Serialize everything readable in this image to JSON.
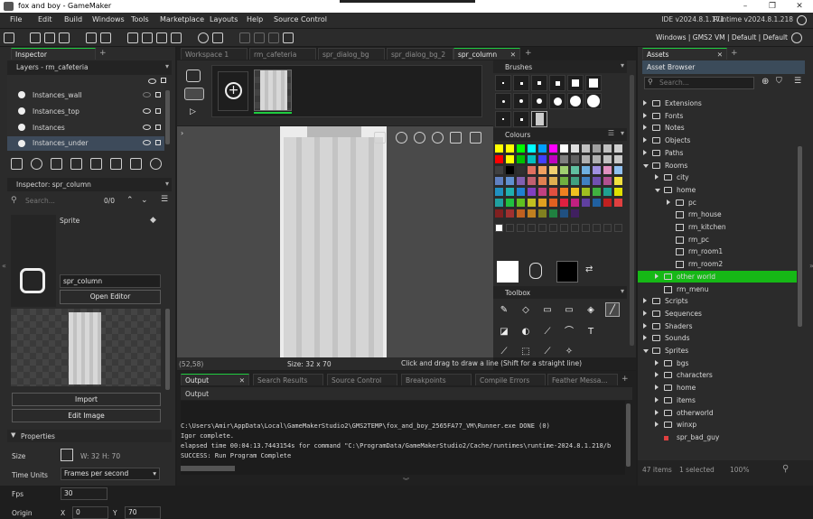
{
  "window": {
    "title": "fox and boy - GameMaker"
  },
  "menu": [
    "File",
    "Edit",
    "Build",
    "Windows",
    "Tools",
    "Marketplace",
    "Layouts",
    "Help",
    "Source Control"
  ],
  "version": {
    "ide": "IDE v2024.8.1.171",
    "runtime": "Runtime v2024.8.1.218"
  },
  "toolbar": {
    "right_label": "Windows | GMS2 VM | Default | Default"
  },
  "left": {
    "tab": "Inspector",
    "layers_title": "Layers - rm_cafeteria",
    "layers": [
      "Instances_wall",
      "Instances_top",
      "Instances",
      "Instances_under"
    ],
    "inspector_title": "Inspector: spr_column",
    "search_placeholder": "Search...",
    "counter": "0/0",
    "sprite_label": "Sprite",
    "sprite_name": "spr_column",
    "open_editor": "Open Editor",
    "import": "Import",
    "edit_image": "Edit Image",
    "properties": "Properties",
    "size_label": "Size",
    "size_w": "W: 32",
    "size_h": "H: 70",
    "time_units_label": "Time Units",
    "time_units_value": "Frames per second",
    "fps_label": "Fps",
    "fps_value": "30",
    "origin_label": "Origin",
    "origin_x_label": "X",
    "origin_x": "0",
    "origin_y_label": "Y",
    "origin_y": "70"
  },
  "center": {
    "tabs": [
      "Workspace 1",
      "rm_cafeteria",
      "spr_dialog_bg",
      "spr_dialog_bg_2",
      "spr_column"
    ],
    "active_tab": "spr_column",
    "coords": "(52,58)",
    "size": "Size: 32 x 70",
    "hint": "Click and drag to draw a line (Shift for a straight line)"
  },
  "brushes": {
    "title": "Brushes"
  },
  "colours": {
    "title": "Colours",
    "swatches": [
      [
        "#ffff00",
        "#ffff00",
        "#00ff00",
        "#00ffff",
        "#00a0ff",
        "#ff00ff",
        "#ffffff",
        "#e0e0e0",
        "#c0c0c0",
        "#a0a0a0",
        "#c0c0c0",
        "#d0d0d0"
      ],
      [
        "#ff0000",
        "#ffff00",
        "#00c000",
        "#00c0c0",
        "#4040ff",
        "#c000c0",
        "#808080",
        "#606060",
        "#b0b0b0",
        "#b0b0b0",
        "#c0c0c0",
        "#c8c8c8"
      ],
      [
        "#404040",
        "#000000",
        "#303030",
        "#e07060",
        "#f0a060",
        "#f0d070",
        "#a0d070",
        "#60c0a0",
        "#70b0e0",
        "#a090e0",
        "#e090c0",
        "#90c0f0"
      ],
      [
        "#6080c0",
        "#6090d0",
        "#8060b0",
        "#c06070",
        "#e08050",
        "#e0b050",
        "#70b040",
        "#40a080",
        "#4080c0",
        "#7050b0",
        "#b05090",
        "#f0e040"
      ],
      [
        "#2090c0",
        "#20b0b0",
        "#2080d0",
        "#8040c0",
        "#c04080",
        "#e05040",
        "#f08020",
        "#f0c020",
        "#a0c020",
        "#40b040",
        "#20a090",
        "#e0e000"
      ],
      [
        "#20a0a0",
        "#20c040",
        "#60c020",
        "#c0c020",
        "#e0a020",
        "#e06020",
        "#e02040",
        "#c02080",
        "#6040a0",
        "#2060a0",
        "#c02020",
        "#e04040"
      ],
      [
        "#802020",
        "#a03030",
        "#c06020",
        "#c08020",
        "#808020",
        "#208040",
        "#205080",
        "#402060"
      ]
    ]
  },
  "toolbox": {
    "title": "Toolbox"
  },
  "assets": {
    "tab": "Assets",
    "title": "Asset Browser",
    "search_placeholder": "Search...",
    "tree": [
      {
        "label": "Extensions",
        "level": 0,
        "type": "folder"
      },
      {
        "label": "Fonts",
        "level": 0,
        "type": "folder"
      },
      {
        "label": "Notes",
        "level": 0,
        "type": "folder"
      },
      {
        "label": "Objects",
        "level": 0,
        "type": "folder"
      },
      {
        "label": "Paths",
        "level": 0,
        "type": "folder"
      },
      {
        "label": "Rooms",
        "level": 0,
        "type": "folder-open"
      },
      {
        "label": "city",
        "level": 1,
        "type": "folder"
      },
      {
        "label": "home",
        "level": 1,
        "type": "folder-open"
      },
      {
        "label": "pc",
        "level": 2,
        "type": "folder"
      },
      {
        "label": "rm_house",
        "level": 2,
        "type": "room"
      },
      {
        "label": "rm_kitchen",
        "level": 2,
        "type": "room"
      },
      {
        "label": "rm_pc",
        "level": 2,
        "type": "room"
      },
      {
        "label": "rm_room1",
        "level": 2,
        "type": "room"
      },
      {
        "label": "rm_room2",
        "level": 2,
        "type": "room"
      },
      {
        "label": "other world",
        "level": 1,
        "type": "folder",
        "selected": true
      },
      {
        "label": "rm_menu",
        "level": 1,
        "type": "room"
      },
      {
        "label": "Scripts",
        "level": 0,
        "type": "folder"
      },
      {
        "label": "Sequences",
        "level": 0,
        "type": "folder"
      },
      {
        "label": "Shaders",
        "level": 0,
        "type": "folder"
      },
      {
        "label": "Sounds",
        "level": 0,
        "type": "folder"
      },
      {
        "label": "Sprites",
        "level": 0,
        "type": "folder-open"
      },
      {
        "label": "bgs",
        "level": 1,
        "type": "folder"
      },
      {
        "label": "characters",
        "level": 1,
        "type": "folder"
      },
      {
        "label": "home",
        "level": 1,
        "type": "folder"
      },
      {
        "label": "items",
        "level": 1,
        "type": "folder"
      },
      {
        "label": "otherworld",
        "level": 1,
        "type": "folder"
      },
      {
        "label": "winxp",
        "level": 1,
        "type": "folder"
      },
      {
        "label": "spr_bad_guy",
        "level": 1,
        "type": "sprite"
      }
    ],
    "status_items": "47 items",
    "status_selected": "1 selected",
    "zoom": "100%"
  },
  "output": {
    "tabs": [
      "Output",
      "Search Results",
      "Source Control",
      "Breakpoints",
      "Compile Errors",
      "Feather Messa..."
    ],
    "header": "Output",
    "lines": [
      "C:\\Users\\Amir\\AppData\\Local\\GameMakerStudio2\\GMS2TEMP\\fox_and_boy_2565FA77_VM\\Runner.exe DONE (0)",
      "Igor complete.",
      "elapsed time 00:04:13.7443154s for command \"C:\\ProgramData/GameMakerStudio2/Cache/runtimes\\runtime-2024.8.1.218/b",
      "SUCCESS: Run Program Complete"
    ]
  },
  "colors": {
    "accent": "#1fcc40",
    "selected_green": "#16b816",
    "bg": "#2b2b2b"
  }
}
